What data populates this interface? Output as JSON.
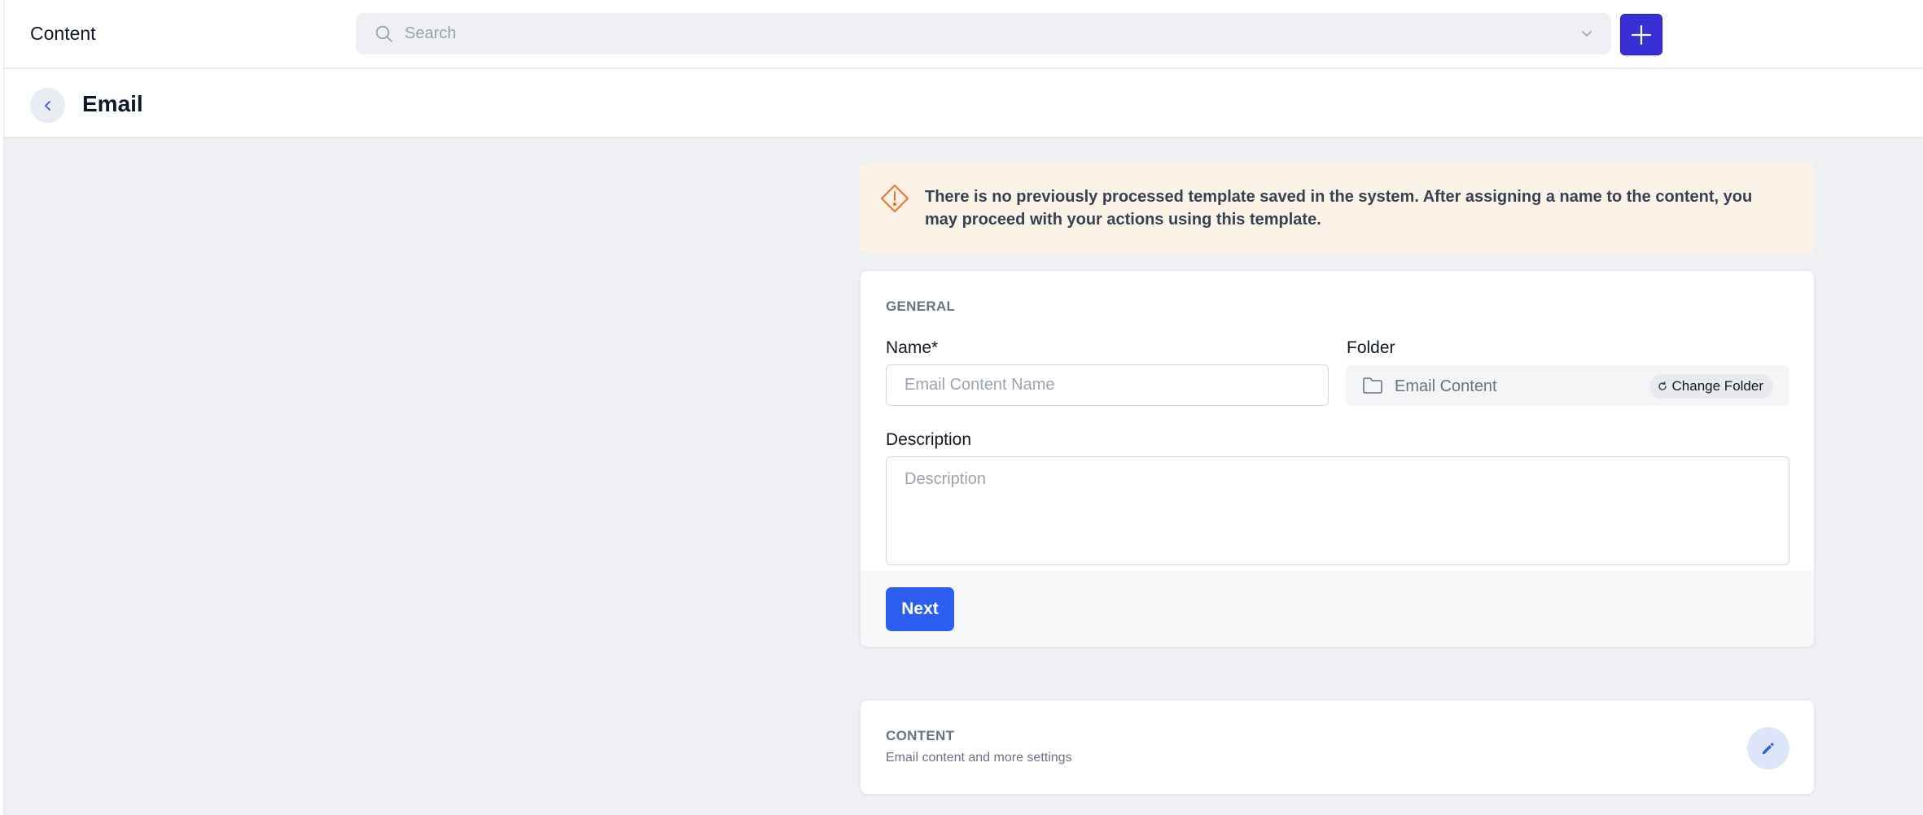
{
  "topbar": {
    "title": "Content",
    "search_placeholder": "Search",
    "icons": {
      "search": "search-icon",
      "dropdown": "chevron-down-icon",
      "add": "plus-icon"
    }
  },
  "page_header": {
    "title": "Email",
    "icons": {
      "back": "chevron-left-icon"
    }
  },
  "alert": {
    "text": "There is no previously processed template saved in the system. After assigning a name to the content, you may proceed with your actions using this template.",
    "icon": "warning-icon",
    "color": "#e8792e"
  },
  "general": {
    "section_label": "GENERAL",
    "name_label": "Name*",
    "name_placeholder": "Email Content Name",
    "name_value": "",
    "folder_label": "Folder",
    "folder_value": "Email Content",
    "change_folder_label": "Change Folder",
    "description_label": "Description",
    "description_placeholder": "Description",
    "description_value": "",
    "next_label": "Next"
  },
  "content_section": {
    "section_label": "CONTENT",
    "subtitle": "Email content and more settings",
    "icons": {
      "edit": "pencil-icon"
    }
  },
  "colors": {
    "primary": "#2c5ff0",
    "add_button": "#3730d4",
    "alert_bg": "#fcf3e8",
    "page_bg": "#eef0f3"
  }
}
